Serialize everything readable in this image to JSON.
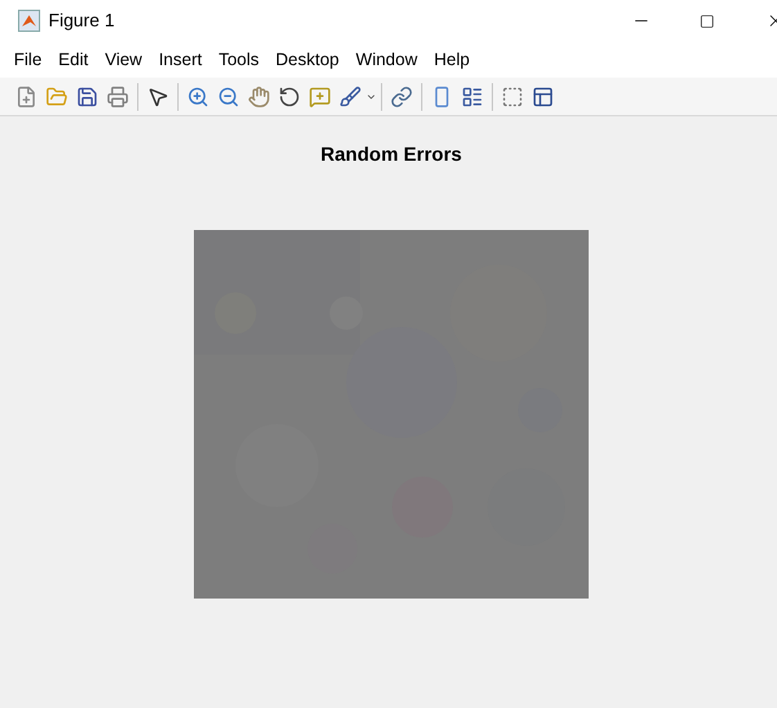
{
  "window": {
    "title": "Figure 1"
  },
  "menu": [
    "File",
    "Edit",
    "View",
    "Insert",
    "Tools",
    "Desktop",
    "Window",
    "Help"
  ],
  "axes": {
    "title": "Random Errors"
  }
}
